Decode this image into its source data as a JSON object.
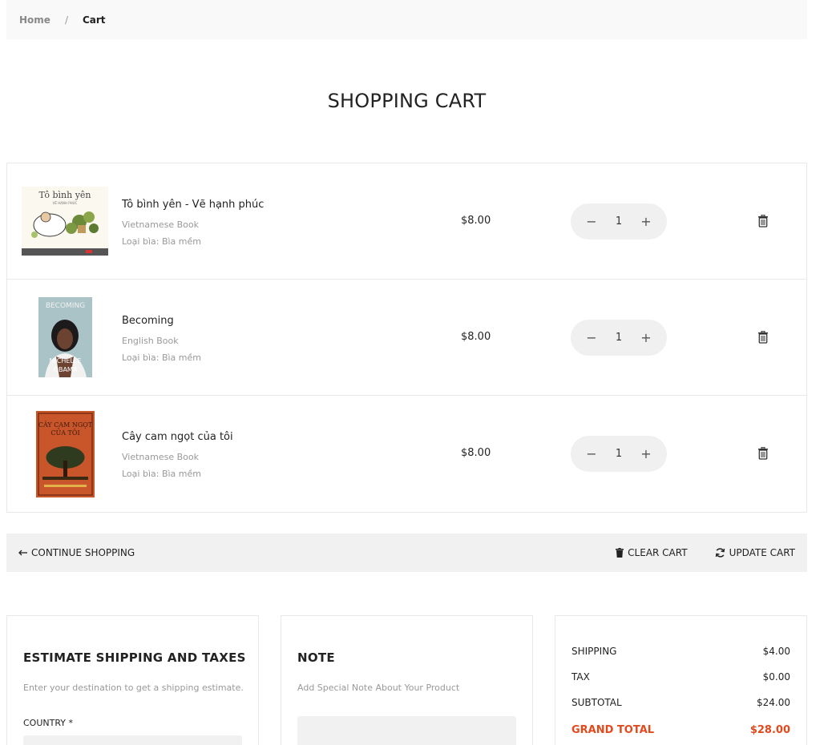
{
  "breadcrumb": {
    "home": "Home",
    "separator": "/",
    "current": "Cart"
  },
  "title": "SHOPPING CART",
  "cart_items": [
    {
      "name": "Tô bình yên - Vẽ hạnh phúc",
      "category": "Vietnamese Book",
      "cover": "Loại bìa: Bìa mềm",
      "price": "$8.00",
      "quantity": "1"
    },
    {
      "name": "Becoming",
      "category": "English Book",
      "cover": "Loại bìa: Bìa mềm",
      "price": "$8.00",
      "quantity": "1"
    },
    {
      "name": "Cây cam ngọt của tôi",
      "category": "Vietnamese Book",
      "cover": "Loại bìa: Bìa mềm",
      "price": "$8.00",
      "quantity": "1"
    }
  ],
  "book_covers": {
    "book1": {
      "title": "Tô bình yên",
      "subtitle": "VẼ HẠNH PHÚC"
    },
    "book2": {
      "top": "BECOMING",
      "author1": "MICHELLE",
      "author2": "OBAMA"
    },
    "book3": {
      "title": "CÂY CAM NGỌT",
      "subtitle": "CỦA TÔI"
    }
  },
  "qty_controls": {
    "minus": "−",
    "plus": "+"
  },
  "actions": {
    "continue": "CONTINUE SHOPPING",
    "clear": "CLEAR CART",
    "update": "UPDATE CART"
  },
  "shipping": {
    "title": "ESTIMATE SHIPPING AND TAXES",
    "description": "Enter your destination to get a shipping estimate.",
    "country_label": "COUNTRY *"
  },
  "note": {
    "title": "NOTE",
    "description": "Add Special Note About Your Product"
  },
  "totals": {
    "shipping_label": "SHIPPING",
    "shipping_value": "$4.00",
    "tax_label": "TAX",
    "tax_value": "$0.00",
    "subtotal_label": "SUBTOTAL",
    "subtotal_value": "$24.00",
    "grand_label": "GRAND TOTAL",
    "grand_value": "$28.00"
  },
  "colors": {
    "accent": "#e24a1d",
    "panel": "#f1f1f1",
    "border": "#e8e8e8"
  }
}
